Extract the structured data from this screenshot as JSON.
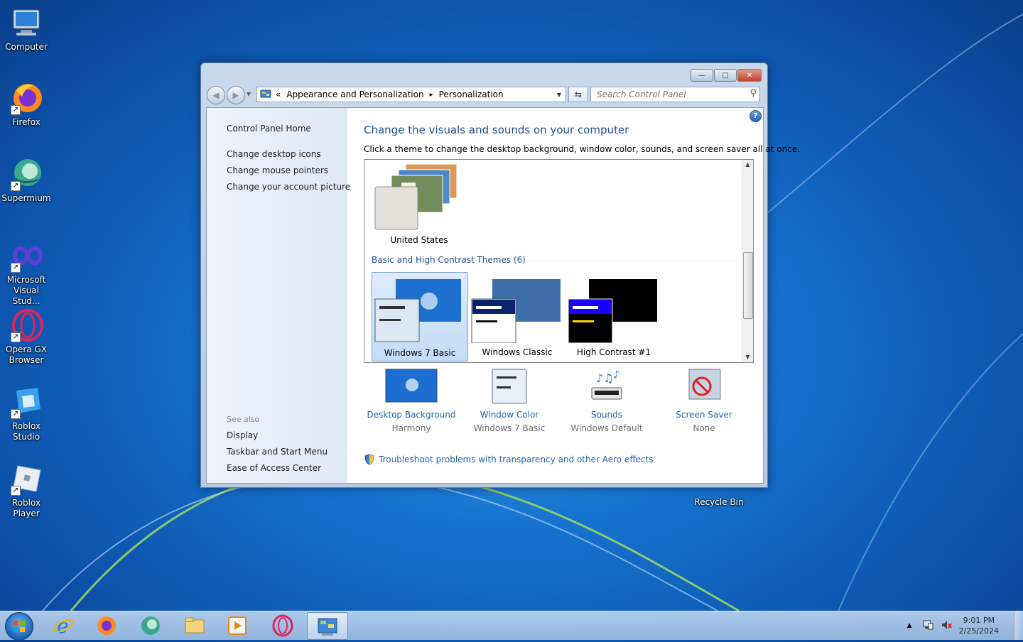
{
  "desktop": {
    "icons": [
      {
        "label_line1": "Computer",
        "label_line2": ""
      },
      {
        "label_line1": "Firefox",
        "label_line2": ""
      },
      {
        "label_line1": "Supermium",
        "label_line2": ""
      },
      {
        "label_line1": "Microsoft",
        "label_line2": "Visual Stud..."
      },
      {
        "label_line1": "Opera GX",
        "label_line2": "Browser"
      },
      {
        "label_line1": "Roblox",
        "label_line2": "Studio"
      },
      {
        "label_line1": "Roblox Player",
        "label_line2": ""
      }
    ],
    "recycle_bin": "Recycle Bin"
  },
  "window": {
    "title_buttons": {
      "minimize": "—",
      "maximize": "□",
      "close": "✕"
    },
    "address": {
      "prefix": "«",
      "crumbs": [
        "Appearance and Personalization",
        "Personalization"
      ],
      "separator": "▸"
    },
    "search": {
      "placeholder": "Search Control Panel"
    },
    "left_pane": {
      "home": "Control Panel Home",
      "links": [
        "Change desktop icons",
        "Change mouse pointers",
        "Change your account picture"
      ],
      "see_also_title": "See also",
      "see_also": [
        "Display",
        "Taskbar and Start Menu",
        "Ease of Access Center"
      ]
    },
    "main": {
      "heading": "Change the visuals and sounds on your computer",
      "subtext": "Click a theme to change the desktop background, window color, sounds, and screen saver all at once.",
      "my_theme": "United States",
      "group_title": "Basic and High Contrast Themes (6)",
      "basic_themes": [
        "Windows 7 Basic",
        "Windows Classic",
        "High Contrast #1"
      ],
      "bottom_items": [
        {
          "label": "Desktop Background",
          "sub": "Harmony"
        },
        {
          "label": "Window Color",
          "sub": "Windows 7 Basic"
        },
        {
          "label": "Sounds",
          "sub": "Windows Default"
        },
        {
          "label": "Screen Saver",
          "sub": "None"
        }
      ],
      "troubleshoot": "Troubleshoot problems with transparency and other Aero effects"
    }
  },
  "taskbar": {
    "clock_time": "9:01 PM",
    "clock_date": "2/25/2024"
  }
}
